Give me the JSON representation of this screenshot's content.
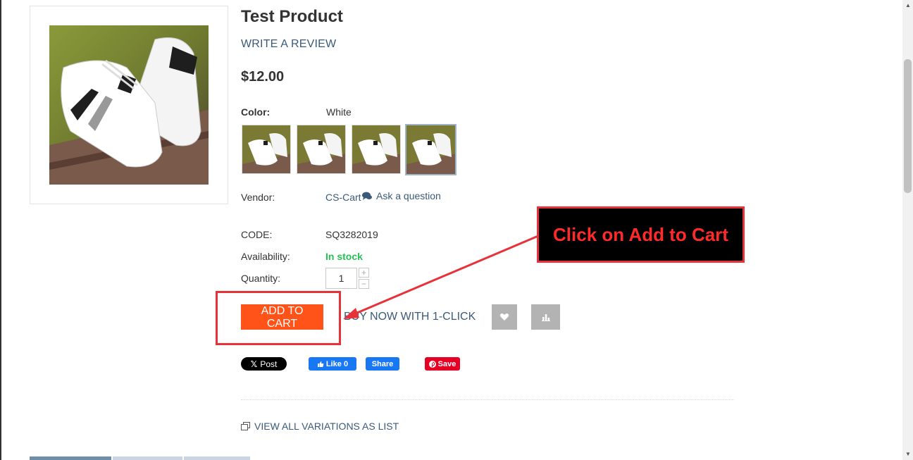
{
  "product": {
    "title": "Test Product",
    "write_review": "WRITE A REVIEW",
    "price": "$12.00"
  },
  "color": {
    "label": "Color:",
    "value": "White",
    "swatch_count": 4,
    "selected_index": 3
  },
  "vendor": {
    "label": "Vendor:",
    "value": "CS-Cart",
    "ask_question": "Ask a question"
  },
  "details": {
    "code_label": "CODE:",
    "code_value": "SQ3282019",
    "availability_label": "Availability:",
    "availability_value": "In stock",
    "quantity_label": "Quantity:",
    "quantity_value": "1"
  },
  "actions": {
    "add_to_cart": "ADD TO CART",
    "buy_now": "BUY NOW WITH 1-CLICK",
    "wishlist_icon": "heart-icon",
    "compare_icon": "bar-chart-icon"
  },
  "social": {
    "x_post": "Post",
    "fb_like": "Like 0",
    "fb_share": "Share",
    "pin_save": "Save"
  },
  "variations_link": "VIEW ALL VARIATIONS AS LIST",
  "annotation": {
    "callout_text": "Click on Add to Cart"
  },
  "colors": {
    "add_to_cart_bg": "#ff5319",
    "in_stock": "#27c156",
    "link": "#3a5a7a",
    "annotation_red": "#e8323a"
  }
}
